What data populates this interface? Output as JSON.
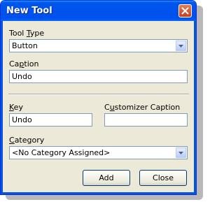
{
  "window": {
    "title": "New Tool"
  },
  "fields": {
    "tool_type": {
      "label_prefix": "Tool ",
      "label_ul": "T",
      "label_rest": "ype",
      "value": "Button"
    },
    "caption": {
      "label_prefix": "Ca",
      "label_ul": "p",
      "label_rest": "tion",
      "value": "Undo"
    },
    "key": {
      "label_ul": "K",
      "label_rest": "ey",
      "value": "Undo"
    },
    "customizer_caption": {
      "label_prefix": "C",
      "label_ul": "u",
      "label_rest": "stomizer Caption",
      "value": ""
    },
    "category": {
      "label_prefix": "",
      "label_ul": "C",
      "label_rest": "ategory",
      "value": "<No Category Assigned>"
    }
  },
  "buttons": {
    "add": "Add",
    "close": "Close"
  },
  "icons": {
    "close": "close-icon",
    "dropdown": "chevron-down-icon"
  }
}
